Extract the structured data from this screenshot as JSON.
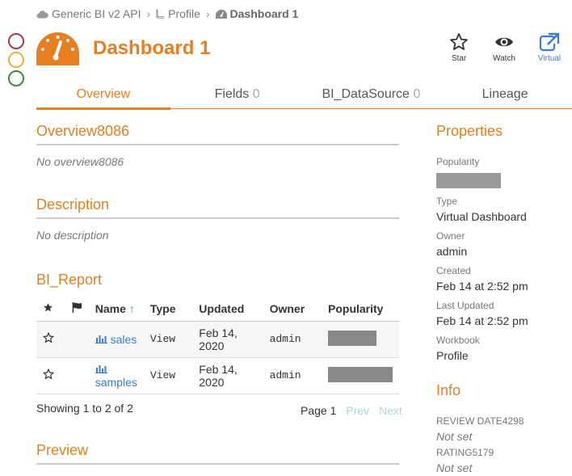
{
  "window_controls": {
    "close_color": "#b03a48",
    "minimize_color": "#e0b24a",
    "maximize_color": "#3a8a3a"
  },
  "breadcrumb": [
    {
      "label": "Generic BI v2 API",
      "icon": "cloud-icon"
    },
    {
      "label": "Profile",
      "icon": "book-icon"
    },
    {
      "label": "Dashboard 1",
      "icon": "dashboard-icon"
    }
  ],
  "header": {
    "title": "Dashboard 1",
    "icon": "gauge-icon"
  },
  "actions": {
    "star": "Star",
    "watch": "Watch",
    "virtual": "Virtual"
  },
  "tabs": [
    {
      "label": "Overview",
      "count": ""
    },
    {
      "label": "Fields",
      "count": "0"
    },
    {
      "label": "BI_DataSource",
      "count": "0"
    },
    {
      "label": "Lineage",
      "count": ""
    }
  ],
  "overview": {
    "title": "Overview8086",
    "text": "No overview8086"
  },
  "description": {
    "title": "Description",
    "text": "No description"
  },
  "report": {
    "title": "BI_Report",
    "columns": [
      "Name",
      "Type",
      "Updated",
      "Owner",
      "Popularity"
    ],
    "rows": [
      {
        "name": "sales",
        "type": "View",
        "updated_line1": "Feb 14,",
        "updated_line2": "2020",
        "owner": "admin",
        "popularity": 0.6
      },
      {
        "name": "samples",
        "type": "View",
        "updated_line1": "Feb 14,",
        "updated_line2": "2020",
        "owner": "admin",
        "popularity": 0.8
      }
    ],
    "showing": "Showing 1 to 2 of 2",
    "page": "Page 1",
    "prev": "Prev",
    "next": "Next"
  },
  "preview": {
    "title": "Preview"
  },
  "properties": {
    "title": "Properties",
    "popularity_label": "Popularity",
    "type_label": "Type",
    "type_value": "Virtual Dashboard",
    "owner_label": "Owner",
    "owner_value": "admin",
    "created_label": "Created",
    "created_value": "Feb 14 at 2:52 pm",
    "updated_label": "Last Updated",
    "updated_value": "Feb 14 at 2:52 pm",
    "workbook_label": "Workbook",
    "workbook_value": "Profile"
  },
  "info": {
    "title": "Info",
    "review_label": "REVIEW DATE4298",
    "review_value": "Not set",
    "rating_label": "RATING5179",
    "rating_value": "Not set"
  },
  "colors": {
    "accent": "#e67e22",
    "link": "#3a7bd5"
  }
}
